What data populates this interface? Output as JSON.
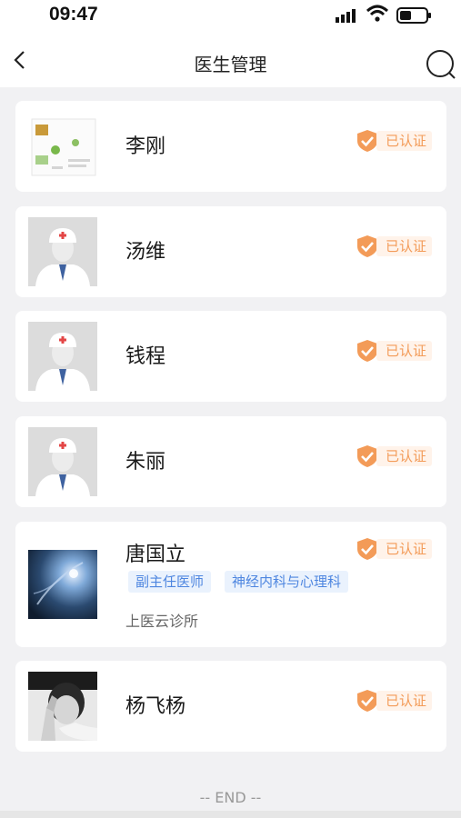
{
  "status": {
    "time": "09:47"
  },
  "nav": {
    "title": "医生管理"
  },
  "doctors": [
    {
      "name": "李刚",
      "status": "已认证",
      "avatar": "license-document"
    },
    {
      "name": "汤维",
      "status": "已认证",
      "avatar": "default-doctor"
    },
    {
      "name": "钱程",
      "status": "已认证",
      "avatar": "default-doctor"
    },
    {
      "name": "朱丽",
      "status": "已认证",
      "avatar": "default-doctor"
    },
    {
      "name": "唐国立",
      "status": "已认证",
      "avatar": "photo",
      "tags": [
        "副主任医师",
        "神经内科与心理科"
      ],
      "clinic": "上医云诊所"
    },
    {
      "name": "杨飞杨",
      "status": "已认证",
      "avatar": "photo-bw"
    }
  ],
  "footer": {
    "end": "-- END --"
  },
  "colors": {
    "badge": "#f39b58",
    "tag": "#4e86e0",
    "background": "#f1f1f3"
  }
}
